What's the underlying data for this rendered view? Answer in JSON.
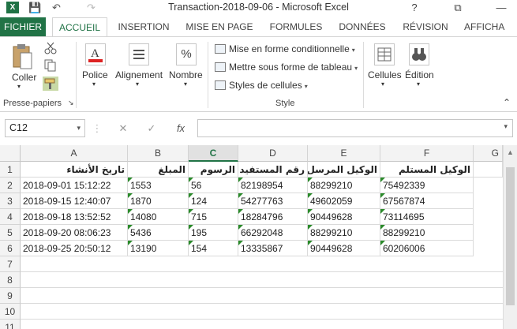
{
  "app": {
    "logo_text": "X",
    "window_title": "Transaction-2018-09-06 - Microsoft Excel",
    "qat": {
      "save": "💾",
      "undo": "↶",
      "redo": "↷"
    },
    "window_buttons": {
      "help": "?",
      "ribbon_options": "⧉",
      "minimize": "—"
    }
  },
  "tabs": [
    "FICHIER",
    "ACCUEIL",
    "INSERTION",
    "MISE EN PAGE",
    "FORMULES",
    "DONNÉES",
    "RÉVISION",
    "AFFICHA"
  ],
  "ribbon": {
    "coller": "Coller",
    "presse_papiers": "Presse-papiers",
    "police": "Police",
    "alignement": "Alignement",
    "nombre": "Nombre",
    "mise_en_forme_cond": "Mise en forme conditionnelle",
    "mettre_sous_forme": "Mettre sous forme de tableau",
    "styles_cellules": "Styles de cellules",
    "style": "Style",
    "cellules": "Cellules",
    "edition": "Édition",
    "dropdown_glyph": "▾",
    "percent_glyph": "%",
    "launcher_glyph": "↘",
    "collapse_glyph": "⌃"
  },
  "formula_bar": {
    "name_box": "C12",
    "cancel": "✕",
    "enter": "✓",
    "fx": "fx",
    "value": ""
  },
  "sheet": {
    "columns": [
      "A",
      "B",
      "C",
      "D",
      "E",
      "F",
      "G"
    ],
    "selected_column": "C",
    "header_row": [
      "تاريخ الأنشاء",
      "المبلغ",
      "الرسوم",
      "رقم المستفيد",
      "الوكيل المرسل",
      "الوكيل المستلم"
    ],
    "rows": [
      [
        "2018-09-01 15:12:22",
        "1553",
        "56",
        "82198954",
        "88299210",
        "75492339"
      ],
      [
        "2018-09-15 12:40:07",
        "1870",
        "124",
        "54277763",
        "49602059",
        "67567874"
      ],
      [
        "2018-09-18 13:52:52",
        "14080",
        "715",
        "18284796",
        "90449628",
        "73114695"
      ],
      [
        "2018-09-20 08:06:23",
        "5436",
        "195",
        "66292048",
        "88299210",
        "88299210"
      ],
      [
        "2018-09-25 20:50:12",
        "13190",
        "154",
        "13335867",
        "90449628",
        "60206006"
      ]
    ],
    "row_numbers": [
      "1",
      "2",
      "3",
      "4",
      "5",
      "6",
      "7",
      "8",
      "9",
      "10",
      "11"
    ]
  }
}
